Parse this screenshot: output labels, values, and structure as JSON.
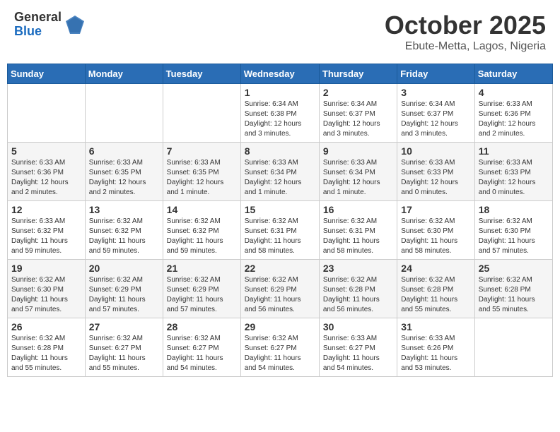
{
  "logo": {
    "general": "General",
    "blue": "Blue"
  },
  "header": {
    "month": "October 2025",
    "location": "Ebute-Metta, Lagos, Nigeria"
  },
  "weekdays": [
    "Sunday",
    "Monday",
    "Tuesday",
    "Wednesday",
    "Thursday",
    "Friday",
    "Saturday"
  ],
  "weeks": [
    [
      {
        "day": "",
        "info": ""
      },
      {
        "day": "",
        "info": ""
      },
      {
        "day": "",
        "info": ""
      },
      {
        "day": "1",
        "info": "Sunrise: 6:34 AM\nSunset: 6:38 PM\nDaylight: 12 hours\nand 3 minutes."
      },
      {
        "day": "2",
        "info": "Sunrise: 6:34 AM\nSunset: 6:37 PM\nDaylight: 12 hours\nand 3 minutes."
      },
      {
        "day": "3",
        "info": "Sunrise: 6:34 AM\nSunset: 6:37 PM\nDaylight: 12 hours\nand 3 minutes."
      },
      {
        "day": "4",
        "info": "Sunrise: 6:33 AM\nSunset: 6:36 PM\nDaylight: 12 hours\nand 2 minutes."
      }
    ],
    [
      {
        "day": "5",
        "info": "Sunrise: 6:33 AM\nSunset: 6:36 PM\nDaylight: 12 hours\nand 2 minutes."
      },
      {
        "day": "6",
        "info": "Sunrise: 6:33 AM\nSunset: 6:35 PM\nDaylight: 12 hours\nand 2 minutes."
      },
      {
        "day": "7",
        "info": "Sunrise: 6:33 AM\nSunset: 6:35 PM\nDaylight: 12 hours\nand 1 minute."
      },
      {
        "day": "8",
        "info": "Sunrise: 6:33 AM\nSunset: 6:34 PM\nDaylight: 12 hours\nand 1 minute."
      },
      {
        "day": "9",
        "info": "Sunrise: 6:33 AM\nSunset: 6:34 PM\nDaylight: 12 hours\nand 1 minute."
      },
      {
        "day": "10",
        "info": "Sunrise: 6:33 AM\nSunset: 6:33 PM\nDaylight: 12 hours\nand 0 minutes."
      },
      {
        "day": "11",
        "info": "Sunrise: 6:33 AM\nSunset: 6:33 PM\nDaylight: 12 hours\nand 0 minutes."
      }
    ],
    [
      {
        "day": "12",
        "info": "Sunrise: 6:33 AM\nSunset: 6:32 PM\nDaylight: 11 hours\nand 59 minutes."
      },
      {
        "day": "13",
        "info": "Sunrise: 6:32 AM\nSunset: 6:32 PM\nDaylight: 11 hours\nand 59 minutes."
      },
      {
        "day": "14",
        "info": "Sunrise: 6:32 AM\nSunset: 6:32 PM\nDaylight: 11 hours\nand 59 minutes."
      },
      {
        "day": "15",
        "info": "Sunrise: 6:32 AM\nSunset: 6:31 PM\nDaylight: 11 hours\nand 58 minutes."
      },
      {
        "day": "16",
        "info": "Sunrise: 6:32 AM\nSunset: 6:31 PM\nDaylight: 11 hours\nand 58 minutes."
      },
      {
        "day": "17",
        "info": "Sunrise: 6:32 AM\nSunset: 6:30 PM\nDaylight: 11 hours\nand 58 minutes."
      },
      {
        "day": "18",
        "info": "Sunrise: 6:32 AM\nSunset: 6:30 PM\nDaylight: 11 hours\nand 57 minutes."
      }
    ],
    [
      {
        "day": "19",
        "info": "Sunrise: 6:32 AM\nSunset: 6:30 PM\nDaylight: 11 hours\nand 57 minutes."
      },
      {
        "day": "20",
        "info": "Sunrise: 6:32 AM\nSunset: 6:29 PM\nDaylight: 11 hours\nand 57 minutes."
      },
      {
        "day": "21",
        "info": "Sunrise: 6:32 AM\nSunset: 6:29 PM\nDaylight: 11 hours\nand 57 minutes."
      },
      {
        "day": "22",
        "info": "Sunrise: 6:32 AM\nSunset: 6:29 PM\nDaylight: 11 hours\nand 56 minutes."
      },
      {
        "day": "23",
        "info": "Sunrise: 6:32 AM\nSunset: 6:28 PM\nDaylight: 11 hours\nand 56 minutes."
      },
      {
        "day": "24",
        "info": "Sunrise: 6:32 AM\nSunset: 6:28 PM\nDaylight: 11 hours\nand 55 minutes."
      },
      {
        "day": "25",
        "info": "Sunrise: 6:32 AM\nSunset: 6:28 PM\nDaylight: 11 hours\nand 55 minutes."
      }
    ],
    [
      {
        "day": "26",
        "info": "Sunrise: 6:32 AM\nSunset: 6:28 PM\nDaylight: 11 hours\nand 55 minutes."
      },
      {
        "day": "27",
        "info": "Sunrise: 6:32 AM\nSunset: 6:27 PM\nDaylight: 11 hours\nand 55 minutes."
      },
      {
        "day": "28",
        "info": "Sunrise: 6:32 AM\nSunset: 6:27 PM\nDaylight: 11 hours\nand 54 minutes."
      },
      {
        "day": "29",
        "info": "Sunrise: 6:32 AM\nSunset: 6:27 PM\nDaylight: 11 hours\nand 54 minutes."
      },
      {
        "day": "30",
        "info": "Sunrise: 6:33 AM\nSunset: 6:27 PM\nDaylight: 11 hours\nand 54 minutes."
      },
      {
        "day": "31",
        "info": "Sunrise: 6:33 AM\nSunset: 6:26 PM\nDaylight: 11 hours\nand 53 minutes."
      },
      {
        "day": "",
        "info": ""
      }
    ]
  ]
}
